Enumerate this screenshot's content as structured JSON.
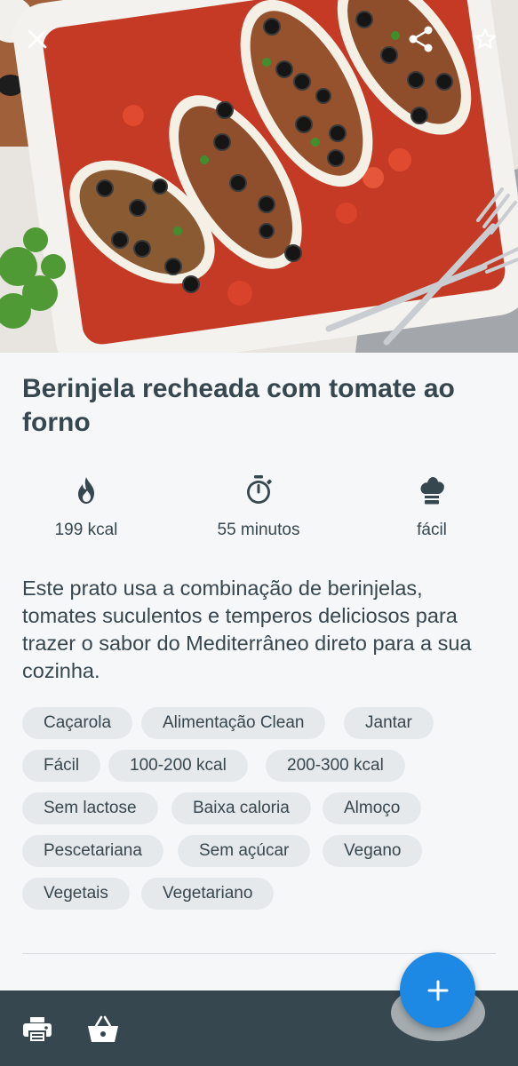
{
  "recipe": {
    "title": "Berinjela recheada com tomate ao forno",
    "description": "Este prato usa a combinação de berinjelas, tomates suculentos e temperos deliciosos para trazer o sabor do Mediterrâneo direto para a sua cozinha."
  },
  "stats": {
    "calories": "199 kcal",
    "time": "55 minutos",
    "difficulty": "fácil"
  },
  "tags": [
    "Caçarola",
    "Alimentação Clean",
    "Jantar",
    "Fácil",
    "100-200 kcal",
    "200-300 kcal",
    "Sem lactose",
    "Baixa caloria",
    "Almoço",
    "Pescetariana",
    "Sem açúcar",
    "Vegano",
    "Vegetais",
    "Vegetariano"
  ],
  "icons": {
    "close": "close-icon",
    "share": "share-icon",
    "favorite": "star-outline-icon",
    "calories": "flame-icon",
    "time": "stopwatch-icon",
    "difficulty": "chef-hat-icon",
    "print": "print-icon",
    "shopping": "basket-icon",
    "add": "plus-icon"
  },
  "colors": {
    "text": "#37474f",
    "chip_bg": "#e6e9ec",
    "bottom_bar": "#37474f",
    "fab": "#1e88e5",
    "background": "#f6f7f9"
  }
}
